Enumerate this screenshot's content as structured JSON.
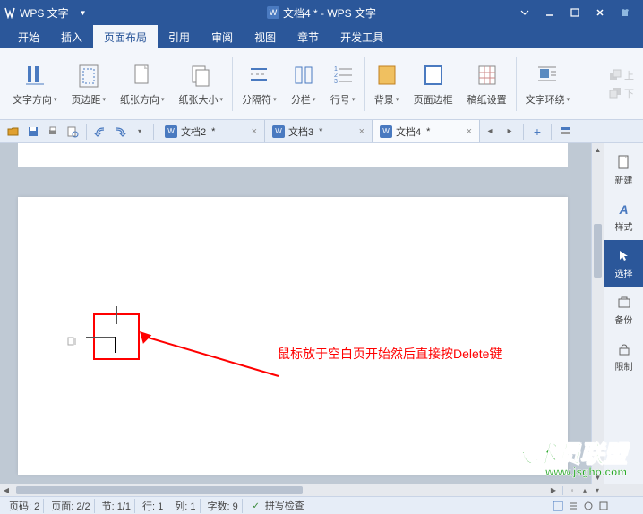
{
  "titlebar": {
    "app_name": "WPS 文字",
    "doc_title": "文档4 * - WPS 文字"
  },
  "menu": {
    "tabs": [
      "开始",
      "插入",
      "页面布局",
      "引用",
      "审阅",
      "视图",
      "章节",
      "开发工具"
    ],
    "active_index": 2
  },
  "ribbon": {
    "items": [
      {
        "label": "文字方向"
      },
      {
        "label": "页边距"
      },
      {
        "label": "纸张方向"
      },
      {
        "label": "纸张大小"
      },
      {
        "label": "分隔符"
      },
      {
        "label": "分栏"
      },
      {
        "label": "行号"
      },
      {
        "label": "背景"
      },
      {
        "label": "页面边框"
      },
      {
        "label": "稿纸设置"
      },
      {
        "label": "文字环绕"
      }
    ],
    "extra": {
      "up": "上",
      "down": "下"
    }
  },
  "doc_tabs": [
    {
      "label": "文档2",
      "dirty": "*",
      "active": false
    },
    {
      "label": "文档3",
      "dirty": "*",
      "active": false
    },
    {
      "label": "文档4",
      "dirty": "*",
      "active": true
    }
  ],
  "annotation": "鼠标放于空白页开始然后直接按Delete键",
  "side": {
    "new": "新建",
    "style": "样式",
    "select": "选择",
    "backup": "备份",
    "limit": "限制"
  },
  "status": {
    "page_no": "页码: 2",
    "page": "页面: 2/2",
    "section": "节: 1/1",
    "line": "行: 1",
    "col": "列: 1",
    "words": "字数: 9",
    "spell": "拼写检查"
  },
  "watermark": {
    "main": "技术员联盟",
    "sub": "www.jsgho.com"
  }
}
